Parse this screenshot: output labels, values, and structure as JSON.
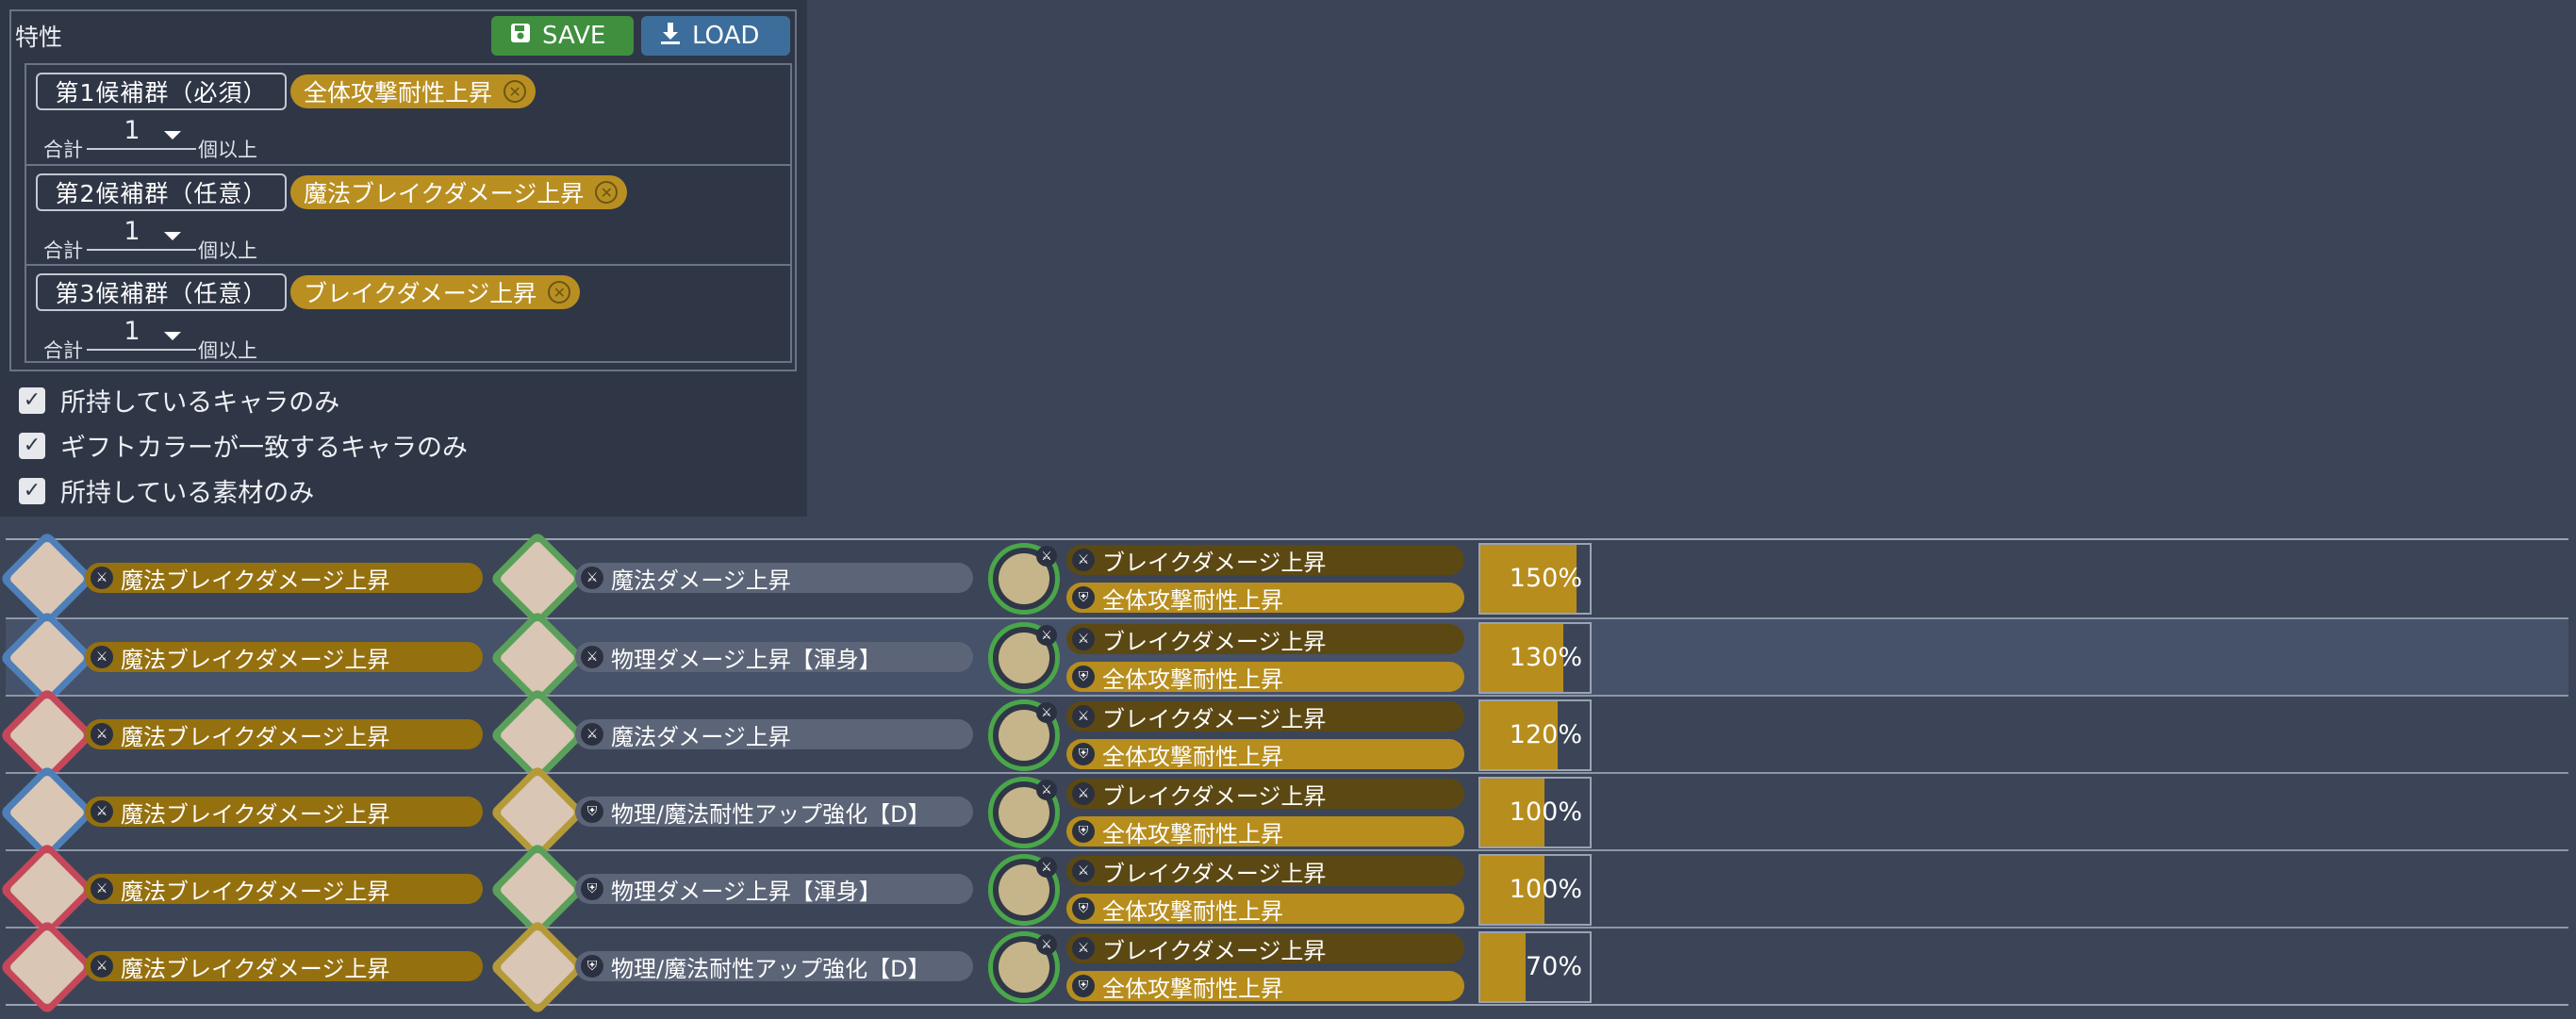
{
  "panel": {
    "title": "特性",
    "save_label": "SAVE",
    "load_label": "LOAD",
    "groups": [
      {
        "label": "第1候補群（必須）",
        "chip": "全体攻撃耐性上昇",
        "total_label": "合計",
        "count": "1",
        "suffix": "個以上"
      },
      {
        "label": "第2候補群（任意）",
        "chip": "魔法ブレイクダメージ上昇",
        "total_label": "合計",
        "count": "1",
        "suffix": "個以上"
      },
      {
        "label": "第3候補群（任意）",
        "chip": "ブレイクダメージ上昇",
        "total_label": "合計",
        "count": "1",
        "suffix": "個以上"
      }
    ],
    "checks": [
      {
        "label": "所持しているキャラのみ",
        "checked": true
      },
      {
        "label": "ギフトカラーが一致するキャラのみ",
        "checked": true
      },
      {
        "label": "所持している素材のみ",
        "checked": true
      }
    ]
  },
  "results": [
    {
      "a_color": "blue",
      "a_trait": "魔法ブレイクダメージ上昇",
      "b_color": "green",
      "b_trait": "魔法ダメージ上昇",
      "b_icon": "sword",
      "s_top": "ブレイクダメージ上昇",
      "s_bot": "全体攻撃耐性上昇",
      "pct_text": "150%",
      "pct": 150
    },
    {
      "a_color": "blue",
      "a_trait": "魔法ブレイクダメージ上昇",
      "b_color": "green",
      "b_trait": "物理ダメージ上昇【渾身】",
      "b_icon": "sword",
      "s_top": "ブレイクダメージ上昇",
      "s_bot": "全体攻撃耐性上昇",
      "pct_text": "130%",
      "pct": 130
    },
    {
      "a_color": "red",
      "a_trait": "魔法ブレイクダメージ上昇",
      "b_color": "green",
      "b_trait": "魔法ダメージ上昇",
      "b_icon": "sword",
      "s_top": "ブレイクダメージ上昇",
      "s_bot": "全体攻撃耐性上昇",
      "pct_text": "120%",
      "pct": 120
    },
    {
      "a_color": "blue",
      "a_trait": "魔法ブレイクダメージ上昇",
      "b_color": "yellow",
      "b_trait": "物理/魔法耐性アップ強化【D】",
      "b_icon": "shield",
      "s_top": "ブレイクダメージ上昇",
      "s_bot": "全体攻撃耐性上昇",
      "pct_text": "100%",
      "pct": 100
    },
    {
      "a_color": "red",
      "a_trait": "魔法ブレイクダメージ上昇",
      "b_color": "green",
      "b_trait": "物理ダメージ上昇【渾身】",
      "b_icon": "shield",
      "s_top": "ブレイクダメージ上昇",
      "s_bot": "全体攻撃耐性上昇",
      "pct_text": "100%",
      "pct": 100
    },
    {
      "a_color": "red",
      "a_trait": "魔法ブレイクダメージ上昇",
      "b_color": "yellow",
      "b_trait": "物理/魔法耐性アップ強化【D】",
      "b_icon": "shield",
      "s_top": "ブレイクダメージ上昇",
      "s_bot": "全体攻撃耐性上昇",
      "pct_text": "70%",
      "pct": 70
    }
  ],
  "colors": {
    "accent_gold": "#b78d1d",
    "save_green": "#3f8f3f",
    "load_blue": "#3d6e9b",
    "frame_blue": "#4f7fb8",
    "frame_red": "#c6475a",
    "frame_green": "#5aa05a",
    "frame_yellow": "#b59a3a",
    "ring_green": "#4aa64a"
  }
}
